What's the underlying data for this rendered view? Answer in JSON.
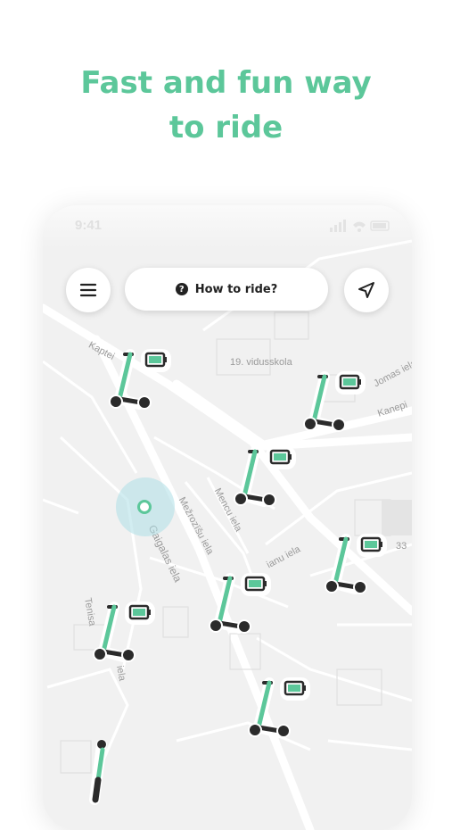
{
  "headline": {
    "line1": "Fast and fun way",
    "line2": "to ride"
  },
  "status_bar": {
    "time": "9:41"
  },
  "toolbar": {
    "menu_icon": "hamburger-menu-icon",
    "help_button_label": "How to ride?",
    "help_icon": "question-circle-icon",
    "locate_icon": "navigation-arrow-icon"
  },
  "map": {
    "street_labels": [
      "Kaptei",
      "19. vidusskola",
      "Jomas iela",
      "Kanepi",
      "Mencu iela",
      "Mežrozīšu iela",
      "Gaigalas iela",
      "Dzintaru iela",
      "ianu iela",
      "33",
      "Tenisa",
      "iela",
      "Irbes iela"
    ],
    "scooters": [
      "scooter-1",
      "scooter-2",
      "scooter-3",
      "scooter-4",
      "scooter-5",
      "scooter-6",
      "scooter-7",
      "scooter-8"
    ]
  },
  "colors": {
    "brand_green": "#5cc79a",
    "scooter_green": "#5cc79a",
    "dark": "#2b2b2b",
    "map_bg": "#f1f1f1"
  }
}
